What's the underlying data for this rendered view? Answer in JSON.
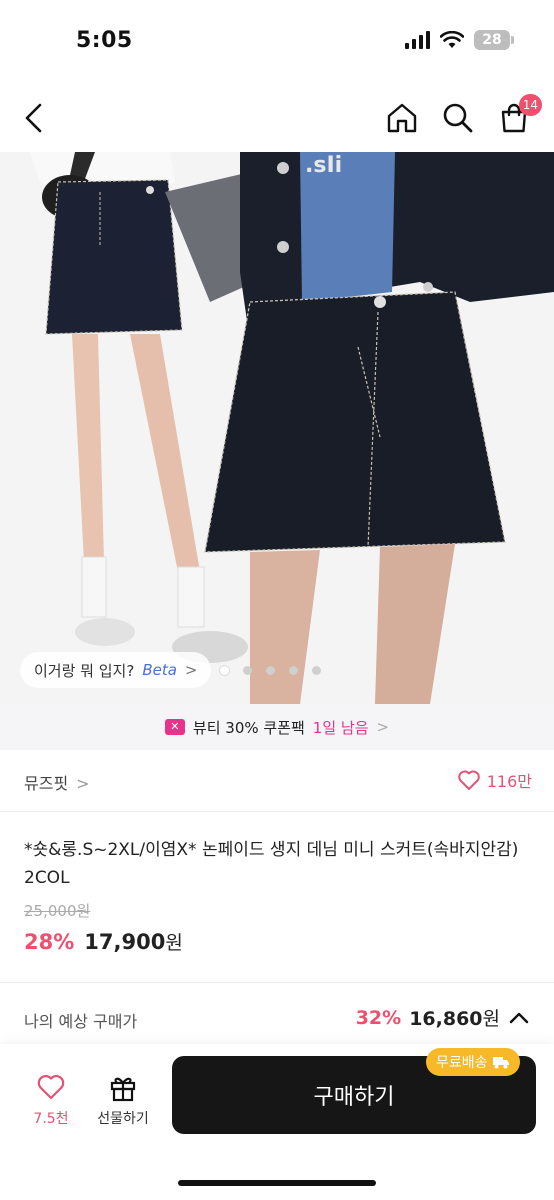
{
  "status_bar": {
    "time": "5:05",
    "battery": "28"
  },
  "nav": {
    "cart_count": "14"
  },
  "hero": {
    "suggest_label": "이거랑 뭐 입지?",
    "suggest_beta": "Beta",
    "suggest_arrow": ">",
    "slide_count": 5,
    "active_slide": 1
  },
  "coupon": {
    "prefix": "뷰티 30% 쿠폰팩",
    "highlight": "1일 남음",
    "arrow": ">"
  },
  "brand": {
    "name": "뮤즈핏",
    "chevron": ">",
    "like_count": "116만"
  },
  "product": {
    "title": "*숏&롱.S~2XL/이염X* 논페이드 생지 데님 미니 스커트(속바지안감) 2COL",
    "original_price": "25,000원",
    "discount": "28%",
    "sale_price": "17,900",
    "currency": "원"
  },
  "expected": {
    "label": "나의 예상 구매가",
    "discount": "32%",
    "price": "16,860",
    "currency": "원"
  },
  "bottom_bar": {
    "like_count": "7.5천",
    "gift_label": "선물하기",
    "buy_label": "구매하기",
    "free_shipping": "무료배송"
  },
  "colors": {
    "accent_pink": "#f0506e",
    "coupon_pink": "#e8338a",
    "free_ship": "#f7b928"
  }
}
